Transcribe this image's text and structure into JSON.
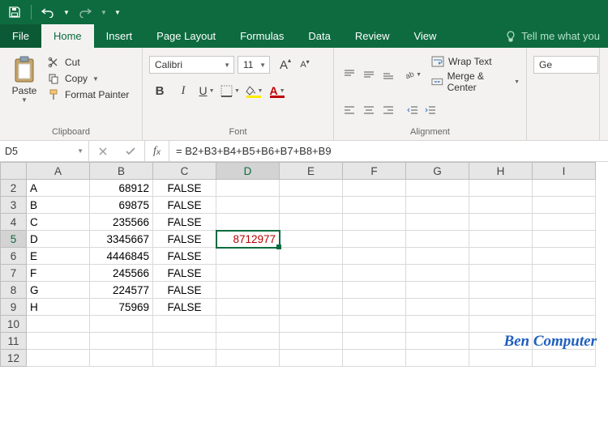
{
  "qat": {
    "save_title": "Save",
    "undo_title": "Undo",
    "redo_title": "Redo"
  },
  "tabs": {
    "file": "File",
    "home": "Home",
    "insert": "Insert",
    "page_layout": "Page Layout",
    "formulas": "Formulas",
    "data": "Data",
    "review": "Review",
    "view": "View",
    "tell_me": "Tell me what you"
  },
  "ribbon": {
    "clipboard": {
      "label": "Clipboard",
      "paste": "Paste",
      "cut": "Cut",
      "copy": "Copy",
      "painter": "Format Painter"
    },
    "font": {
      "label": "Font",
      "name": "Calibri",
      "size": "11"
    },
    "alignment": {
      "label": "Alignment",
      "wrap": "Wrap Text",
      "merge": "Merge & Center"
    },
    "number": {
      "format": "Ge"
    }
  },
  "namebox": "D5",
  "formula": "= B2+B3+B4+B5+B6+B7+B8+B9",
  "columns": [
    "A",
    "B",
    "C",
    "D",
    "E",
    "F",
    "G",
    "H",
    "I"
  ],
  "rows": [
    {
      "n": 2,
      "A": "A",
      "B": "68912",
      "C": "FALSE",
      "D": ""
    },
    {
      "n": 3,
      "A": "B",
      "B": "69875",
      "C": "FALSE",
      "D": ""
    },
    {
      "n": 4,
      "A": "C",
      "B": "235566",
      "C": "FALSE",
      "D": ""
    },
    {
      "n": 5,
      "A": "D",
      "B": "3345667",
      "C": "FALSE",
      "D": "8712977"
    },
    {
      "n": 6,
      "A": "E",
      "B": "4446845",
      "C": "FALSE",
      "D": ""
    },
    {
      "n": 7,
      "A": "F",
      "B": "245566",
      "C": "FALSE",
      "D": ""
    },
    {
      "n": 8,
      "A": "G",
      "B": "224577",
      "C": "FALSE",
      "D": ""
    },
    {
      "n": 9,
      "A": "H",
      "B": "75969",
      "C": "FALSE",
      "D": ""
    },
    {
      "n": 10
    },
    {
      "n": 11
    },
    {
      "n": 12
    }
  ],
  "active": {
    "row": 5,
    "col": "D"
  },
  "watermark": "Ben Computer"
}
